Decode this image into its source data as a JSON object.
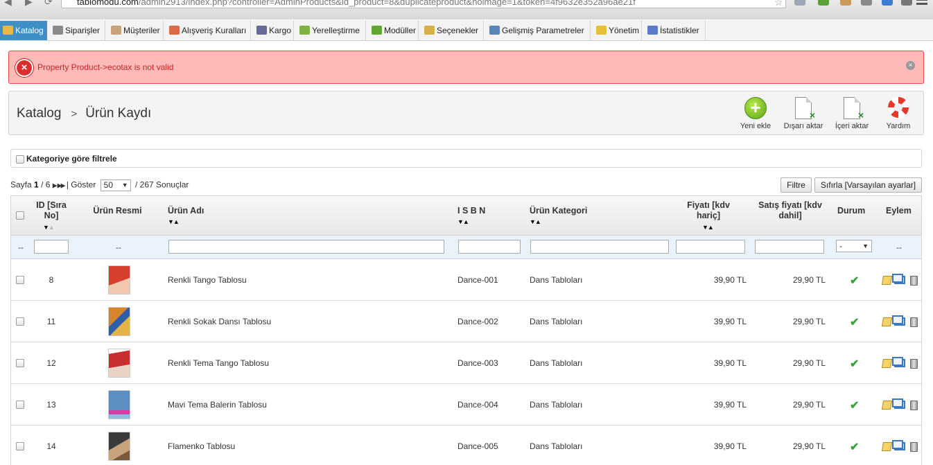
{
  "browser": {
    "url_host": "tablomodu.com",
    "url_path": "/admin2913/index.php?controller=AdminProducts&id_product=8&duplicateproduct&noimage=1&token=4f9632e352a96ae21f"
  },
  "tabs": [
    {
      "label": "Katalog",
      "icon": "folder-icon",
      "color": "#e6b84b"
    },
    {
      "label": "Siparişler",
      "icon": "cart-icon",
      "color": "#8a8a8a"
    },
    {
      "label": "Müşteriler",
      "icon": "customers-icon",
      "color": "#c9a27a"
    },
    {
      "label": "Alışveriş Kuralları",
      "icon": "price-rules-icon",
      "color": "#d86a4a"
    },
    {
      "label": "Kargo",
      "icon": "truck-icon",
      "color": "#6a6a9a"
    },
    {
      "label": "Yerelleştirme",
      "icon": "globe-icon",
      "color": "#7cb342"
    },
    {
      "label": "Modüller",
      "icon": "puzzle-icon",
      "color": "#5ea62e"
    },
    {
      "label": "Seçenekler",
      "icon": "preferences-icon",
      "color": "#d8b04b"
    },
    {
      "label": "Gelişmiş Parametreler",
      "icon": "wrench-icon",
      "color": "#5b84b8"
    },
    {
      "label": "Yönetim",
      "icon": "key-icon",
      "color": "#e5c13a"
    },
    {
      "label": "İstatistikler",
      "icon": "bar-chart-icon",
      "color": "#5a7bc9"
    }
  ],
  "error": {
    "message": "Property Product->ecotax is not valid"
  },
  "header": {
    "breadcrumb_root": "Katalog",
    "breadcrumb_sep": ">",
    "breadcrumb_current": "Ürün Kaydı",
    "toolbar": {
      "add_label": "Yeni ekle",
      "export_label": "Dışarı aktar",
      "import_label": "İçeri aktar",
      "help_label": "Yardım"
    }
  },
  "category_filter_label": "Kategoriye göre filtrele",
  "pager": {
    "page_prefix": "Sayfa",
    "current_page": "1",
    "total_pages": "/ 6",
    "show_label": "| Göster",
    "per_page": "50",
    "results": "/ 267 Sonuçlar"
  },
  "buttons": {
    "filter": "Filtre",
    "reset": "Sıfırla [Varsayılan ayarlar]"
  },
  "columns": {
    "id": "ID [Sıra No]",
    "image": "Ürün Resmi",
    "name": "Ürün Adı",
    "isbn": "I S B N",
    "category": "Ürün Kategori",
    "price": "Fiyatı [kdv hariç]",
    "sale_price": "Satış fiyatı [kdv dahil]",
    "status": "Durum",
    "actions": "Eylem"
  },
  "filter_row": {
    "dash": "--",
    "status_select": "-"
  },
  "rows": [
    {
      "id": "8",
      "name": "Renkli Tango Tablosu",
      "isbn": "Dance-001",
      "category": "Dans Tabloları",
      "price": "39,90 TL",
      "sale_price": "29,90 TL",
      "thumb_a": "#d8402e",
      "thumb_b": "#f2c7b0"
    },
    {
      "id": "11",
      "name": "Renkli Sokak Dansı Tablosu",
      "isbn": "Dance-002",
      "category": "Dans Tabloları",
      "price": "39,90 TL",
      "sale_price": "29,90 TL",
      "thumb_a": "#d9832b",
      "thumb_b": "#2e5fa8"
    },
    {
      "id": "12",
      "name": "Renkli Tema Tango Tablosu",
      "isbn": "Dance-003",
      "category": "Dans Tabloları",
      "price": "39,90 TL",
      "sale_price": "29,90 TL",
      "thumb_a": "#c92e2e",
      "thumb_b": "#e9d3c6"
    },
    {
      "id": "13",
      "name": "Mavi Tema Balerin Tablosu",
      "isbn": "Dance-004",
      "category": "Dans Tabloları",
      "price": "39,90 TL",
      "sale_price": "29,90 TL",
      "thumb_a": "#5c8fc4",
      "thumb_b": "#d33fa5"
    },
    {
      "id": "14",
      "name": "Flamenko Tablosu",
      "isbn": "Dance-005",
      "category": "Dans Tabloları",
      "price": "39,90 TL",
      "sale_price": "29,90 TL",
      "thumb_a": "#3b3b3b",
      "thumb_b": "#c7a27a"
    }
  ]
}
